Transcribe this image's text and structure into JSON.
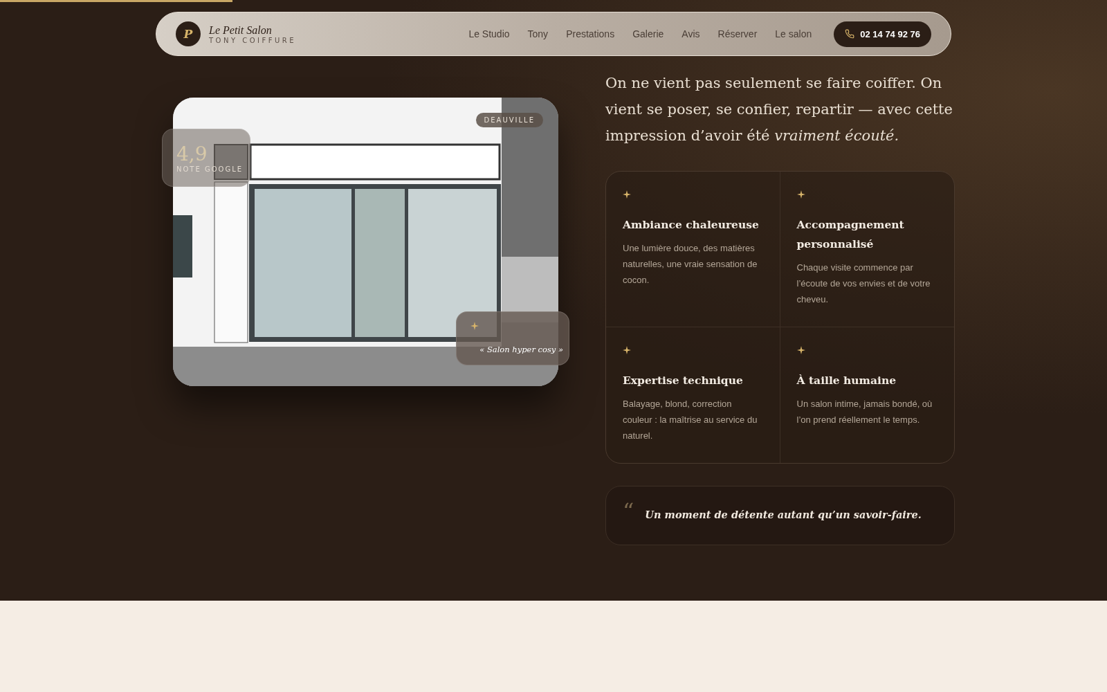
{
  "scroll_progress": {
    "level": 0.21
  },
  "header": {
    "logo_letter": "P",
    "brand": "Le Petit Salon",
    "tagline": "TONY COIFFURE",
    "nav": [
      {
        "label": "Le Studio"
      },
      {
        "label": "Tony"
      },
      {
        "label": "Prestations"
      },
      {
        "label": "Galerie"
      },
      {
        "label": "Avis"
      },
      {
        "label": "Réserver"
      },
      {
        "label": "Le salon"
      }
    ],
    "phone": "02 14 74 92 76"
  },
  "photo": {
    "location_tag": "DEAUVILLE",
    "rating": "4,9",
    "rating_label": "NOTE GOOGLE",
    "review_quote": "« Salon hyper cosy »"
  },
  "intro": "On ne vient pas seulement se faire coiffer. On vient se poser, se confier, repartir — avec cette impression d’avoir été *vraiment écouté.*",
  "features": [
    {
      "title": "Ambiance chaleureuse",
      "text": "Une lumière douce, des matières naturelles, une vraie sensation de cocon."
    },
    {
      "title": "Accompagnement personnalisé",
      "text": "Chaque visite commence par l’écoute de vos envies et de votre cheveu."
    },
    {
      "title": "Expertise technique",
      "text": "Balayage, blond, correction couleur : la maîtrise au service du naturel."
    },
    {
      "title": "À taille humaine",
      "text": "Un salon intime, jamais bondé, où l’on prend réellement le temps."
    }
  ],
  "quote": {
    "mark": "“",
    "text": "Un moment de détente autant qu’un savoir-faire."
  }
}
